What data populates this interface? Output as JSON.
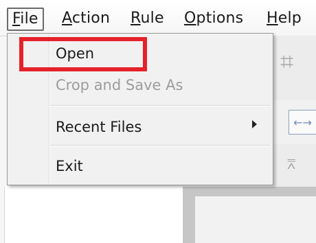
{
  "menubar": {
    "file": "File",
    "action": "Action",
    "rule": "Rule",
    "options": "Options",
    "help": "Help"
  },
  "file_menu": {
    "open": "Open",
    "crop_and_save_as": "Crop and Save As",
    "recent_files": "Recent Files",
    "exit": "Exit"
  },
  "annotation": {
    "highlight_color": "#e5212b",
    "highlighted_item": "Open"
  },
  "icons": [
    "grid-icon",
    "arrow-left-right-icon",
    "align-top-icon",
    "submenu-arrow-icon"
  ]
}
